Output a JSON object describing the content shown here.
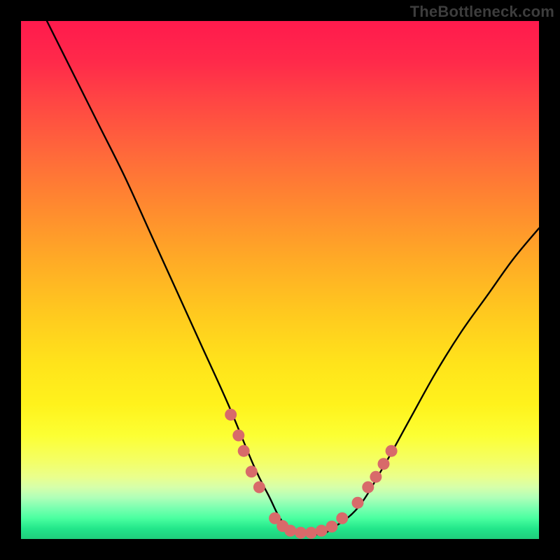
{
  "watermark": "TheBottleneck.com",
  "chart_data": {
    "type": "line",
    "title": "",
    "xlabel": "",
    "ylabel": "",
    "xlim": [
      0,
      100
    ],
    "ylim": [
      0,
      100
    ],
    "series": [
      {
        "name": "curve",
        "x": [
          5,
          10,
          15,
          20,
          25,
          30,
          35,
          40,
          45,
          48,
          50,
          52,
          55,
          58,
          60,
          65,
          70,
          75,
          80,
          85,
          90,
          95,
          100
        ],
        "y": [
          100,
          90,
          80,
          70,
          59,
          48,
          37,
          26,
          14,
          8,
          4,
          2,
          1,
          1,
          2,
          6,
          14,
          23,
          32,
          40,
          47,
          54,
          60
        ]
      }
    ],
    "markers": {
      "name": "dots",
      "color": "#d86a6a",
      "points": [
        {
          "x": 40.5,
          "y": 24
        },
        {
          "x": 42.0,
          "y": 20
        },
        {
          "x": 43.0,
          "y": 17
        },
        {
          "x": 44.5,
          "y": 13
        },
        {
          "x": 46.0,
          "y": 10
        },
        {
          "x": 49.0,
          "y": 4
        },
        {
          "x": 50.5,
          "y": 2.5
        },
        {
          "x": 52.0,
          "y": 1.6
        },
        {
          "x": 54.0,
          "y": 1.2
        },
        {
          "x": 56.0,
          "y": 1.2
        },
        {
          "x": 58.0,
          "y": 1.6
        },
        {
          "x": 60.0,
          "y": 2.4
        },
        {
          "x": 62.0,
          "y": 4
        },
        {
          "x": 65.0,
          "y": 7
        },
        {
          "x": 67.0,
          "y": 10
        },
        {
          "x": 68.5,
          "y": 12
        },
        {
          "x": 70.0,
          "y": 14.5
        },
        {
          "x": 71.5,
          "y": 17
        }
      ]
    }
  }
}
